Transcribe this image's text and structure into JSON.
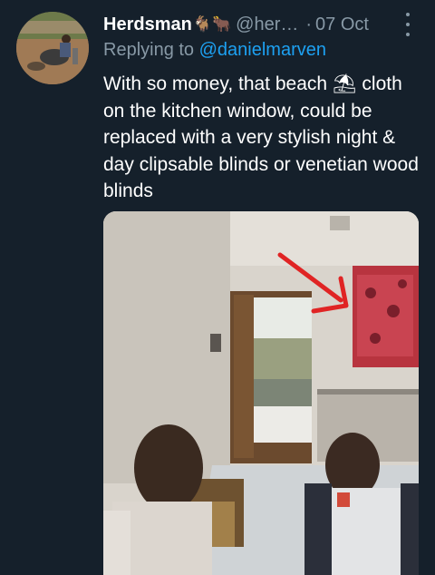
{
  "tweet": {
    "display_name": "Herdsman",
    "name_emojis": "🐐🐂",
    "handle": "@her…",
    "separator": "·",
    "date": "07 Oct",
    "replying_prefix": "Replying to",
    "replying_to": "@danielmarven",
    "text": "With so money, that beach ⛱ cloth on the kitchen window, could be replaced with a very  stylish night & day clipsable blinds or venetian wood blinds"
  },
  "colors": {
    "background": "#15202b",
    "secondary_text": "#8899a6",
    "link": "#1da1f2",
    "primary_text": "#ffffff"
  },
  "icons": {
    "more": "more-vertical-icon"
  }
}
